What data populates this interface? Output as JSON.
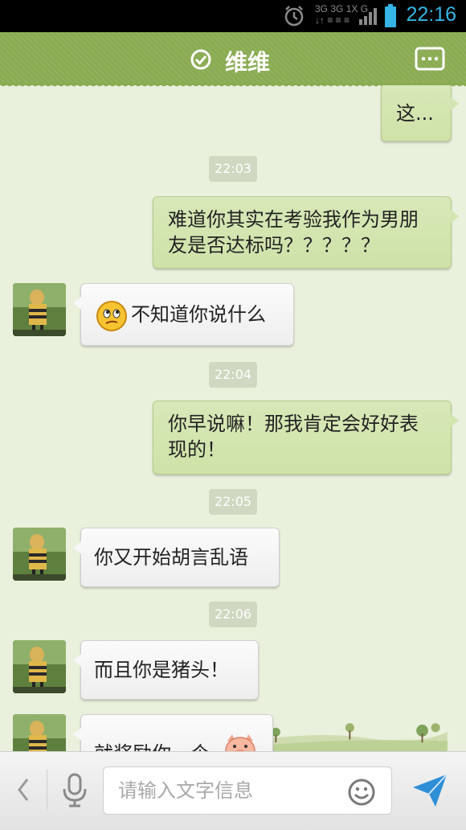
{
  "status_bar": {
    "time": "22:16",
    "network": "3G",
    "icons": [
      "alarm-icon",
      "network-3g-icon",
      "signal-icon",
      "battery-icon"
    ]
  },
  "header": {
    "title": "维维",
    "status_icon": "online-check-icon",
    "menu_icon": "more-dots-icon"
  },
  "messages": [
    {
      "type": "out",
      "text": "这..."
    },
    {
      "type": "time",
      "text": "22:03"
    },
    {
      "type": "out",
      "text": "难道你其实在考验我作为男朋友是否达标吗？？？？？"
    },
    {
      "type": "in",
      "text": "不知道你说什么",
      "emoji": "confused-face-icon"
    },
    {
      "type": "time",
      "text": "22:04"
    },
    {
      "type": "out",
      "text": "你早说嘛！那我肯定会好好表现的！"
    },
    {
      "type": "time",
      "text": "22:05"
    },
    {
      "type": "in",
      "text": "你又开始胡言乱语"
    },
    {
      "type": "time",
      "text": "22:06"
    },
    {
      "type": "in",
      "text": "而且你是猪头！"
    },
    {
      "type": "in",
      "text": "就奖励你一个",
      "emoji": "pig-face-icon",
      "partial": true
    }
  ],
  "input_bar": {
    "placeholder": "请输入文字信息",
    "icons": [
      "back-chevron-icon",
      "microphone-icon",
      "smiley-icon",
      "send-icon"
    ]
  },
  "colors": {
    "header": "#8aab52",
    "chat_bg": "#e9f0dc",
    "outgoing_bubble": "#d3e5b0",
    "incoming_bubble": "#f7f7f7",
    "status_accent": "#35b5e5",
    "send": "#2f8fd6"
  }
}
